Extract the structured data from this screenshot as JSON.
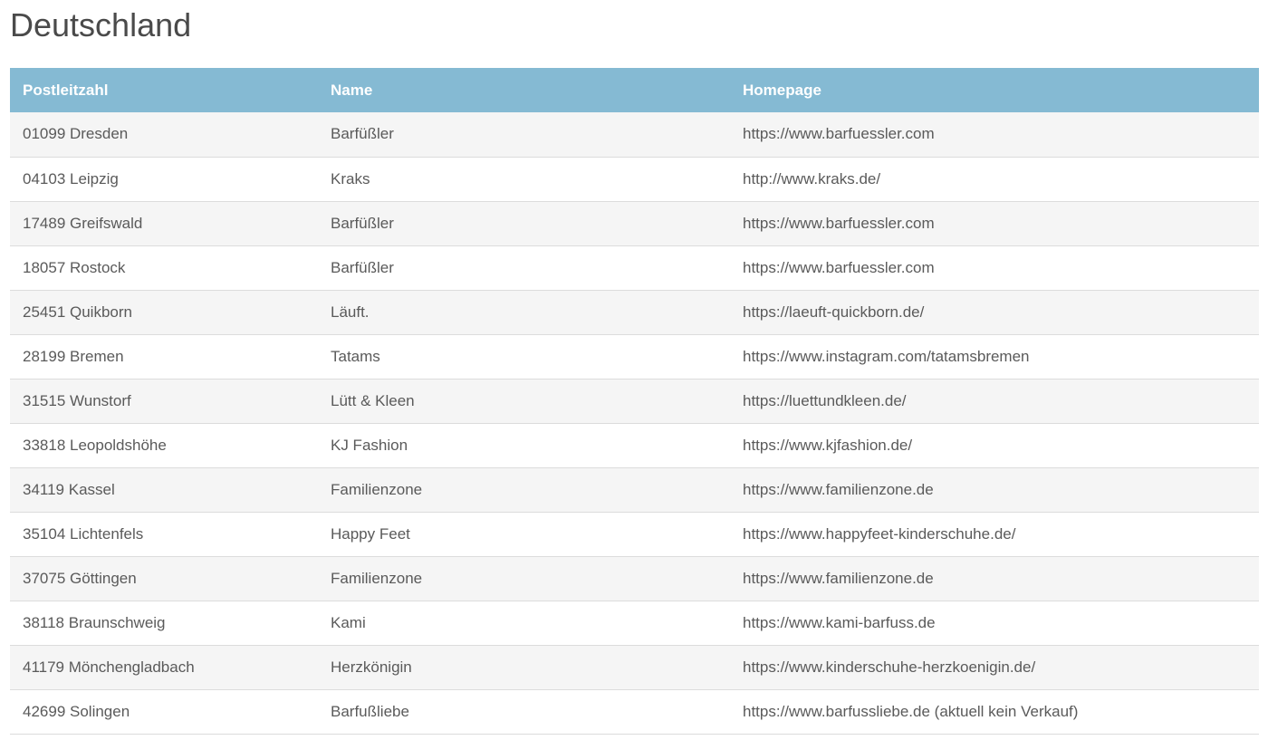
{
  "page": {
    "title": "Deutschland"
  },
  "table": {
    "headers": {
      "zip": "Postleitzahl",
      "name": "Name",
      "homepage": "Homepage"
    },
    "rows": [
      {
        "zip": "01099 Dresden",
        "name": "Barfüßler",
        "homepage": "https://www.barfuessler.com"
      },
      {
        "zip": "04103 Leipzig",
        "name": "Kraks",
        "homepage": "http://www.kraks.de/"
      },
      {
        "zip": "17489 Greifswald",
        "name": "Barfüßler",
        "homepage": "https://www.barfuessler.com"
      },
      {
        "zip": "18057 Rostock",
        "name": "Barfüßler",
        "homepage": "https://www.barfuessler.com"
      },
      {
        "zip": "25451 Quikborn",
        "name": "Läuft.",
        "homepage": "https://laeuft-quickborn.de/"
      },
      {
        "zip": "28199 Bremen",
        "name": "Tatams",
        "homepage": "https://www.instagram.com/tatamsbremen"
      },
      {
        "zip": "31515 Wunstorf",
        "name": "Lütt & Kleen",
        "homepage": "https://luettundkleen.de/"
      },
      {
        "zip": "33818 Leopoldshöhe",
        "name": "KJ Fashion",
        "homepage": "https://www.kjfashion.de/"
      },
      {
        "zip": "34119 Kassel",
        "name": "Familienzone",
        "homepage": "https://www.familienzone.de"
      },
      {
        "zip": "35104 Lichtenfels",
        "name": "Happy Feet",
        "homepage": "https://www.happyfeet-kinderschuhe.de/"
      },
      {
        "zip": "37075 Göttingen",
        "name": "Familienzone",
        "homepage": "https://www.familienzone.de"
      },
      {
        "zip": "38118 Braunschweig",
        "name": "Kami",
        "homepage": "https://www.kami-barfuss.de"
      },
      {
        "zip": "41179 Mönchengladbach",
        "name": "Herzkönigin",
        "homepage": "https://www.kinderschuhe-herzkoenigin.de/"
      },
      {
        "zip": "42699 Solingen",
        "name": "Barfußliebe",
        "homepage": "https://www.barfussliebe.de (aktuell kein Verkauf)"
      }
    ]
  },
  "colors": {
    "header_background": "#85bad3",
    "header_text": "#ffffff",
    "row_stripe": "#f5f5f5",
    "row_border": "#dcdcdc",
    "body_text": "#5a5a5a"
  }
}
